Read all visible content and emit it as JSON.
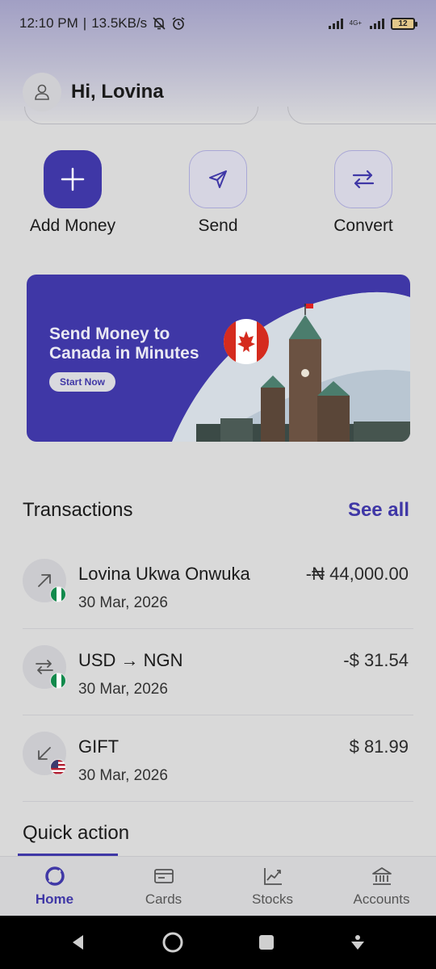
{
  "status_bar": {
    "time": "12:10 PM",
    "separator": "|",
    "speed": "13.5KB/s",
    "network": "4G+",
    "battery": "12"
  },
  "header": {
    "greeting": "Hi, Lovina"
  },
  "actions": [
    {
      "label": "Add Money",
      "icon": "plus-icon"
    },
    {
      "label": "Send",
      "icon": "send-icon"
    },
    {
      "label": "Convert",
      "icon": "convert-icon"
    }
  ],
  "banner": {
    "title": "Send Money to Canada in Minutes",
    "cta": "Start Now"
  },
  "transactions": {
    "title": "Transactions",
    "see_all": "See all",
    "items": [
      {
        "name": "Lovina Ukwa Onwuka",
        "date": "30 Mar, 2026",
        "amount": "-₦ 44,000.00",
        "icon": "arrow-up-right-icon",
        "flag": "nigeria-flag-icon"
      },
      {
        "name": "USD → NGN",
        "date": "30 Mar, 2026",
        "amount": "-$ 31.54",
        "icon": "convert-icon",
        "flag": "nigeria-flag-icon"
      },
      {
        "name": "GIFT",
        "date": "30 Mar, 2026",
        "amount": "$ 81.99",
        "icon": "arrow-down-left-icon",
        "flag": "usa-flag-icon"
      }
    ]
  },
  "quick_action": {
    "title": "Quick action"
  },
  "bottom_nav": [
    {
      "label": "Home",
      "icon": "home-icon",
      "active": true
    },
    {
      "label": "Cards",
      "icon": "card-icon",
      "active": false
    },
    {
      "label": "Stocks",
      "icon": "chart-icon",
      "active": false
    },
    {
      "label": "Accounts",
      "icon": "bank-icon",
      "active": false
    }
  ],
  "colors": {
    "accent": "#3f37a6",
    "background": "#d9d9d9"
  }
}
